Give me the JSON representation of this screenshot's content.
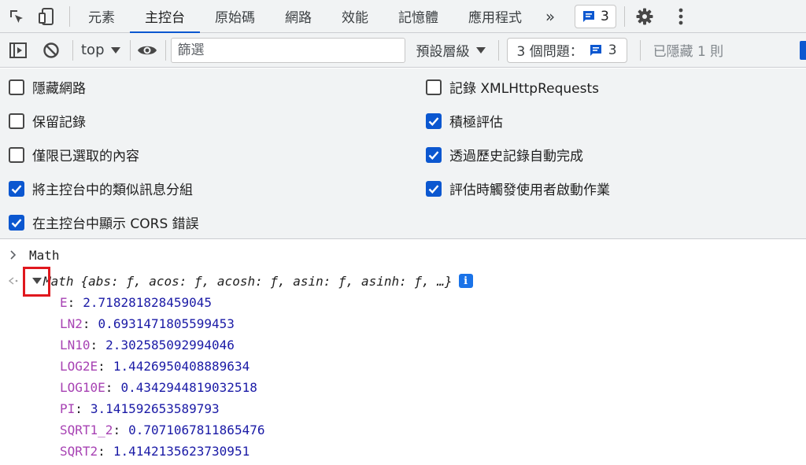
{
  "tabbar": {
    "tabs": [
      {
        "label": "元素",
        "active": false
      },
      {
        "label": "主控台",
        "active": true
      },
      {
        "label": "原始碼",
        "active": false
      },
      {
        "label": "網路",
        "active": false
      },
      {
        "label": "效能",
        "active": false
      },
      {
        "label": "記憶體",
        "active": false
      },
      {
        "label": "應用程式",
        "active": false
      }
    ],
    "more_label": "»",
    "issues_count": "3",
    "icons": [
      "inspect-element-icon",
      "device-toolbar-icon",
      "chevrons-right-icon",
      "message-icon",
      "gear-icon",
      "kebab-menu-icon"
    ]
  },
  "toolbar": {
    "context": "top",
    "filter_placeholder": "篩選",
    "log_levels": "預設層級",
    "issues_label": "3 個問題：",
    "issues_count": "3",
    "hidden_label": "已隱藏 1 則",
    "icons": [
      "sidebar-toggle-icon",
      "clear-console-icon",
      "eye-icon",
      "dropdown-arrow-icon"
    ]
  },
  "settings": {
    "left": [
      {
        "label": "隱藏網路",
        "checked": false
      },
      {
        "label": "保留記錄",
        "checked": false
      },
      {
        "label": "僅限已選取的內容",
        "checked": false
      },
      {
        "label": "將主控台中的類似訊息分組",
        "checked": true
      },
      {
        "label": "在主控台中顯示 CORS 錯誤",
        "checked": true
      }
    ],
    "right": [
      {
        "label": "記錄 XMLHttpRequests",
        "checked": false
      },
      {
        "label": "積極評估",
        "checked": true
      },
      {
        "label": "透過歷史記錄自動完成",
        "checked": true
      },
      {
        "label": "評估時觸發使用者啟動作業",
        "checked": true
      }
    ]
  },
  "console": {
    "input": "Math",
    "result_name": "Math",
    "result_preview": "{abs: ƒ, acos: ƒ, acosh: ƒ, asin: ƒ, asinh: ƒ, …}",
    "info_glyph": "i",
    "properties": [
      {
        "key": "E",
        "value": "2.718281828459045"
      },
      {
        "key": "LN2",
        "value": "0.6931471805599453"
      },
      {
        "key": "LN10",
        "value": "2.302585092994046"
      },
      {
        "key": "LOG2E",
        "value": "1.4426950408889634"
      },
      {
        "key": "LOG10E",
        "value": "0.4342944819032518"
      },
      {
        "key": "PI",
        "value": "3.141592653589793"
      },
      {
        "key": "SQRT1_2",
        "value": "0.7071067811865476"
      },
      {
        "key": "SQRT2",
        "value": "1.4142135623730951"
      }
    ]
  },
  "colors": {
    "accent": "#0b57d0",
    "highlight": "#e0181e",
    "prop_key": "#a742b3",
    "prop_number": "#1a1aa6"
  }
}
